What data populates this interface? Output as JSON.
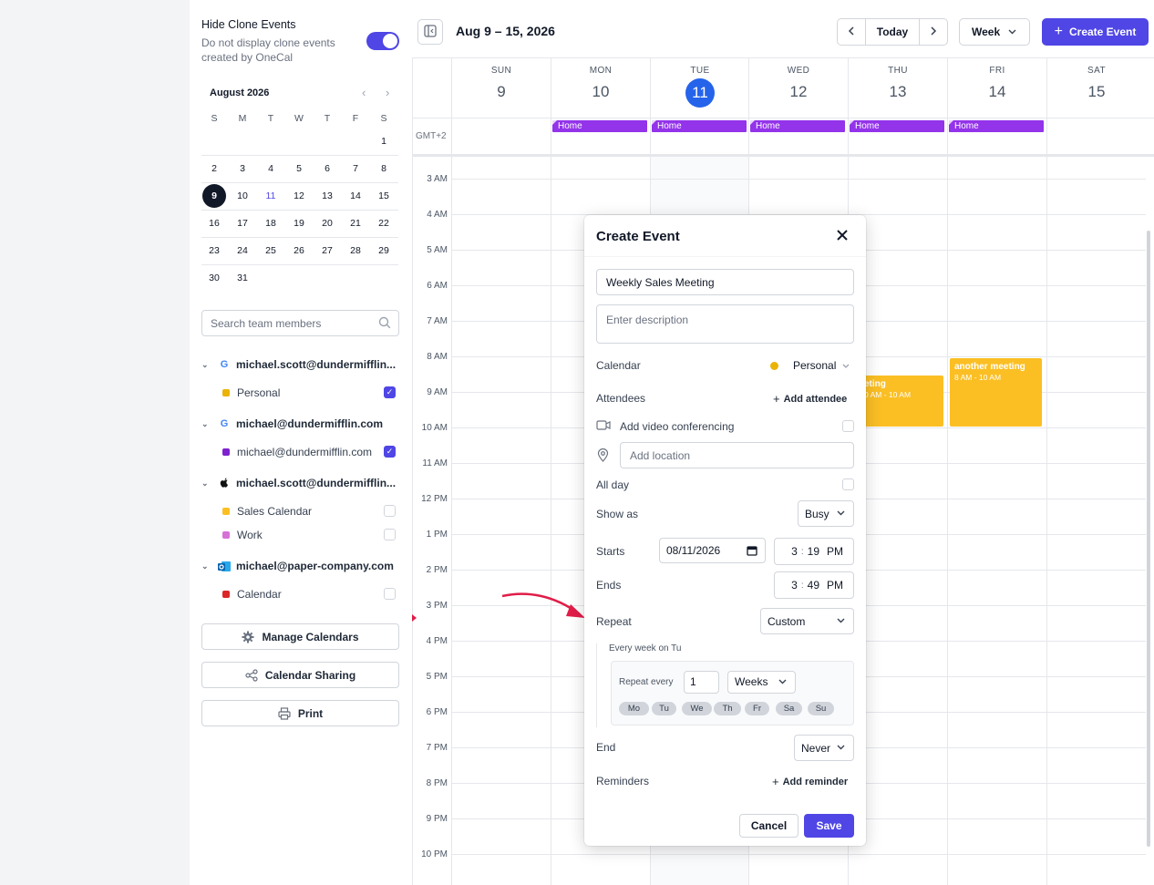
{
  "sidebar": {
    "hide_clone_title": "Hide Clone Events",
    "hide_clone_desc": "Do not display clone events created by OneCal",
    "hide_clone_on": true,
    "mini_cal": {
      "month": "August 2026",
      "weekdays": [
        "S",
        "M",
        "T",
        "W",
        "T",
        "F",
        "S"
      ],
      "weeks": [
        [
          "",
          "",
          "",
          "",
          "",
          "",
          "1"
        ],
        [
          "2",
          "3",
          "4",
          "5",
          "6",
          "7",
          "8"
        ],
        [
          "9",
          "10",
          "11",
          "12",
          "13",
          "14",
          "15"
        ],
        [
          "16",
          "17",
          "18",
          "19",
          "20",
          "21",
          "22"
        ],
        [
          "23",
          "24",
          "25",
          "26",
          "27",
          "28",
          "29"
        ],
        [
          "30",
          "31",
          "",
          "",
          "",
          "",
          ""
        ]
      ],
      "selected": "9",
      "today": "11"
    },
    "search_placeholder": "Search team members",
    "accounts": [
      {
        "name": "michael.scott@dundermifflin...",
        "logo": "google-icon",
        "calendars": [
          {
            "label": "Personal",
            "color": "#eab308",
            "checked": true
          }
        ]
      },
      {
        "name": "michael@dundermifflin.com",
        "logo": "google-icon",
        "calendars": [
          {
            "label": "michael@dundermifflin.com",
            "color": "#7e22ce",
            "checked": true
          }
        ]
      },
      {
        "name": "michael.scott@dundermifflin...",
        "logo": "apple-icon",
        "calendars": [
          {
            "label": "Sales Calendar",
            "color": "#fbbf24",
            "checked": false
          },
          {
            "label": "Work",
            "color": "#d671d6",
            "checked": false
          }
        ]
      },
      {
        "name": "michael@paper-company.com",
        "logo": "outlook-icon",
        "calendars": [
          {
            "label": "Calendar",
            "color": "#dc2626",
            "checked": false
          }
        ]
      }
    ],
    "manage_calendars": "Manage Calendars",
    "calendar_sharing": "Calendar Sharing",
    "print": "Print"
  },
  "header": {
    "date_range": "Aug 9 – 15, 2026",
    "today": "Today",
    "view": "Week",
    "create_event": "Create Event"
  },
  "calendar": {
    "days": [
      {
        "name": "SUN",
        "date": "9"
      },
      {
        "name": "MON",
        "date": "10"
      },
      {
        "name": "TUE",
        "date": "11",
        "today": true
      },
      {
        "name": "WED",
        "date": "12"
      },
      {
        "name": "THU",
        "date": "13"
      },
      {
        "name": "FRI",
        "date": "14"
      },
      {
        "name": "SAT",
        "date": "15"
      }
    ],
    "timezone": "GMT+2",
    "allday_chip": "Home",
    "hours": [
      "3 AM",
      "4 AM",
      "5 AM",
      "6 AM",
      "7 AM",
      "8 AM",
      "9 AM",
      "10 AM",
      "11 AM",
      "12 PM",
      "1 PM",
      "2 PM",
      "3 PM",
      "4 PM",
      "5 PM",
      "6 PM",
      "7 PM",
      "8 PM",
      "9 PM",
      "10 PM"
    ],
    "events": [
      {
        "title": "eting",
        "time": "0 AM - 10 AM"
      },
      {
        "title": "another meeting",
        "time": "8 AM - 10 AM"
      }
    ]
  },
  "modal": {
    "title": "Create Event",
    "event_title": "Weekly Sales Meeting",
    "description_placeholder": "Enter description",
    "calendar_label": "Calendar",
    "calendar_value": "Personal",
    "attendees_label": "Attendees",
    "add_attendee": "Add attendee",
    "video_label": "Add video conferencing",
    "location_placeholder": "Add location",
    "allday_label": "All day",
    "show_as_label": "Show as",
    "show_as_value": "Busy",
    "starts_label": "Starts",
    "start_date": "08/11/2026",
    "start_hour": "3",
    "start_min": "19",
    "start_ampm": "PM",
    "ends_label": "Ends",
    "end_hour": "3",
    "end_min": "49",
    "end_ampm": "PM",
    "repeat_label": "Repeat",
    "repeat_value": "Custom",
    "repeat_summary": "Every week on Tu",
    "repeat_every_label": "Repeat every",
    "repeat_every_value": "1",
    "repeat_unit": "Weeks",
    "weekdays": [
      "Mo",
      "Tu",
      "We",
      "Th",
      "Fr",
      "Sa",
      "Su"
    ],
    "end_label": "End",
    "end_value": "Never",
    "reminders_label": "Reminders",
    "add_reminder": "Add reminder",
    "cancel": "Cancel",
    "save": "Save"
  }
}
